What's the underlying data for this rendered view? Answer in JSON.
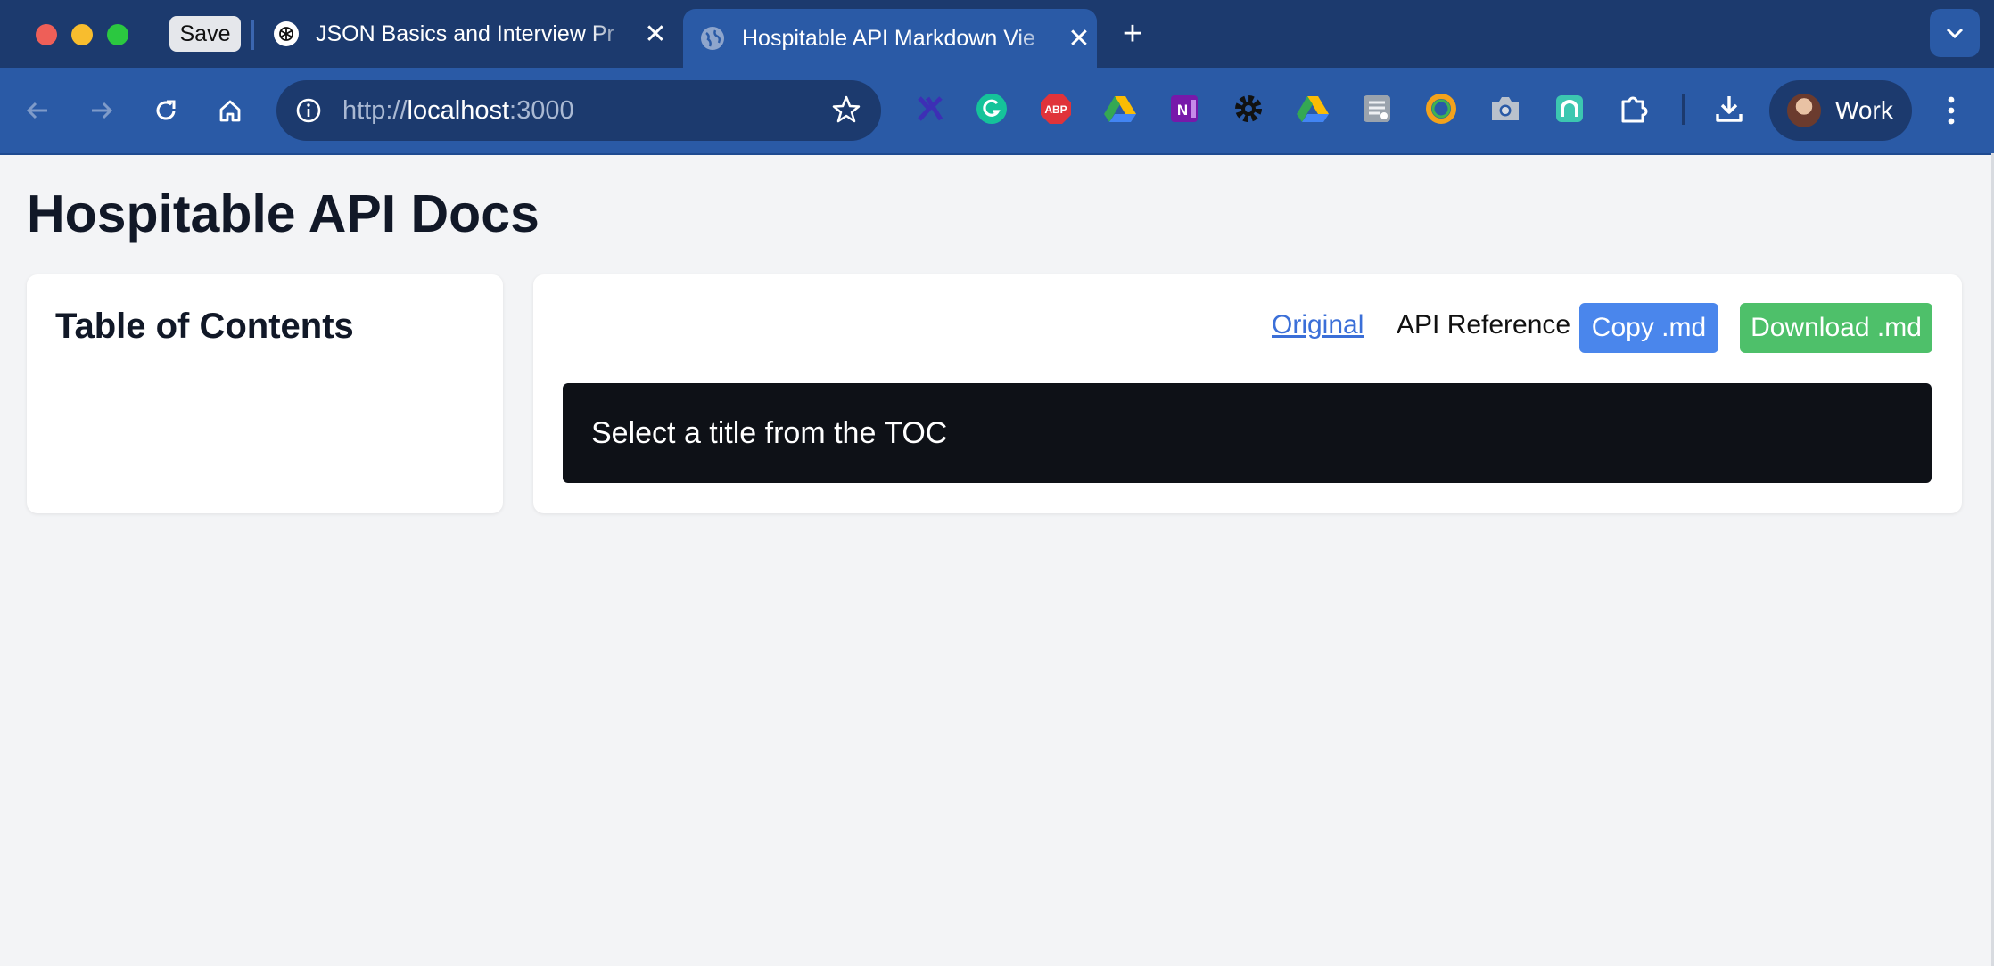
{
  "browser": {
    "save_label": "Save",
    "tabs": [
      {
        "title": "JSON Basics and Interview Pr",
        "favicon": "openai-icon",
        "active": false
      },
      {
        "title": "Hospitable API Markdown Vie",
        "favicon": "globe-icon",
        "active": true
      }
    ],
    "url_scheme": "http://",
    "url_host": "localhost",
    "url_port": ":3000",
    "profile_label": "Work",
    "extensions": [
      "x-icon",
      "grammarly-icon",
      "adblock-icon",
      "google-drive-icon",
      "onenote-icon",
      "gear-icon",
      "google-drive-icon",
      "stack-icon",
      "ring-icon",
      "camera-icon",
      "teal-app-icon",
      "puzzle-icon"
    ],
    "adblock_text": "ABP",
    "colors": {
      "chrome_dark": "#1c3a6e",
      "chrome": "#2a5aa6"
    }
  },
  "page": {
    "title": "Hospitable API Docs",
    "toc_title": "Table of Contents",
    "original_link": "Original",
    "api_reference": "API Reference",
    "copy_button": "Copy .md",
    "download_button": "Download .md",
    "placeholder_text": "Select a title from the TOC",
    "colors": {
      "copy": "#4a86ec",
      "download": "#4ec06a",
      "content_bg": "#0e1117"
    }
  }
}
